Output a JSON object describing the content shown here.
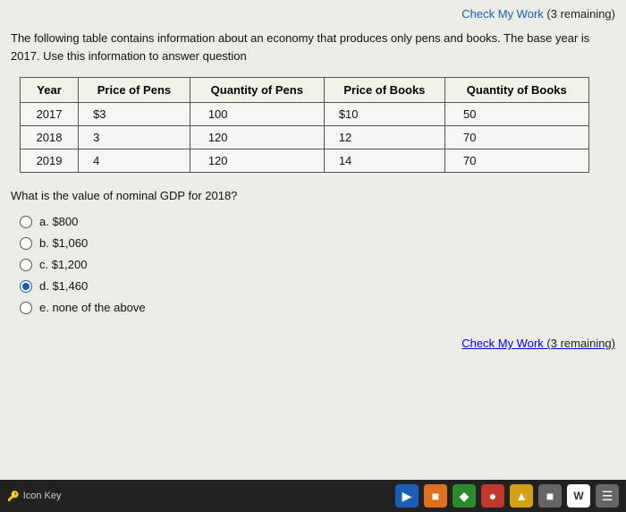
{
  "header": {
    "check_my_work": "Check My Work",
    "remaining": "(3 remaining)"
  },
  "intro": {
    "text": "The following table contains information about an economy that produces only pens and books. The base year is 2017. Use this information to answer question"
  },
  "table": {
    "columns": [
      "Year",
      "Price of Pens",
      "Quantity of Pens",
      "Price of Books",
      "Quantity of Books"
    ],
    "rows": [
      {
        "year": "2017",
        "price_pens": "$3",
        "qty_pens": "100",
        "price_books": "$10",
        "qty_books": "50"
      },
      {
        "year": "2018",
        "price_pens": "3",
        "qty_pens": "120",
        "price_books": "12",
        "qty_books": "70"
      },
      {
        "year": "2019",
        "price_pens": "4",
        "qty_pens": "120",
        "price_books": "14",
        "qty_books": "70"
      }
    ]
  },
  "question": {
    "text": "What is the value of nominal GDP for 2018?"
  },
  "options": [
    {
      "id": "a",
      "label": "a. $800",
      "selected": false
    },
    {
      "id": "b",
      "label": "b. $1,060",
      "selected": false
    },
    {
      "id": "c",
      "label": "c. $1,200",
      "selected": false
    },
    {
      "id": "d",
      "label": "d. $1,460",
      "selected": true
    },
    {
      "id": "e",
      "label": "e. none of the above",
      "selected": false
    }
  ],
  "footer": {
    "check_my_work": "Check My Work",
    "remaining": "(3 remaining)"
  },
  "taskbar": {
    "icon_key_label": "Icon Key"
  }
}
